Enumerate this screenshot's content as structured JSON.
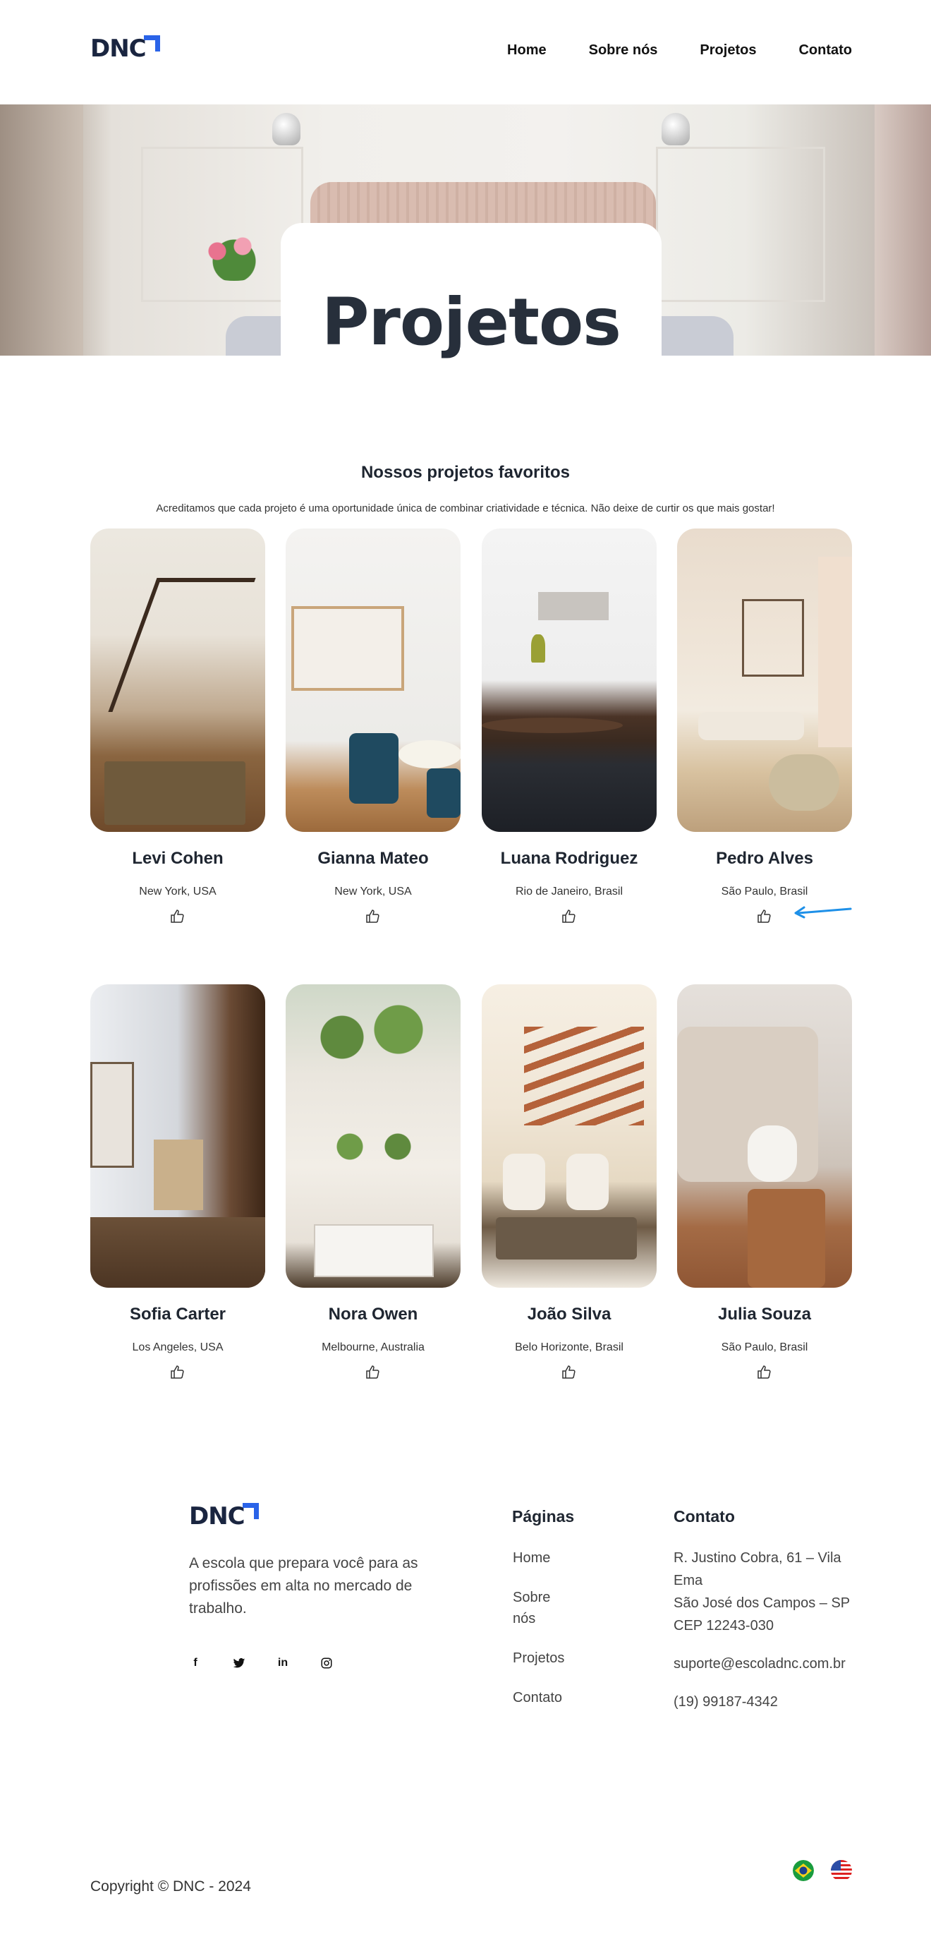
{
  "brand": {
    "logo_text": "DNC",
    "accent_color": "#2a63e8"
  },
  "nav": {
    "items": [
      {
        "label": "Home"
      },
      {
        "label": "Sobre nós"
      },
      {
        "label": "Projetos"
      },
      {
        "label": "Contato"
      }
    ]
  },
  "hero": {
    "title": "Projetos"
  },
  "section": {
    "heading": "Nossos projetos favoritos",
    "subtitle": "Acreditamos que cada projeto é uma oportunidade única de combinar criatividade e técnica. Não deixe de curtir os que mais gostar!"
  },
  "projects": [
    {
      "name": "Levi Cohen",
      "location": "New York, USA",
      "like_icon": "thumbs-up-icon"
    },
    {
      "name": "Gianna Mateo",
      "location": "New York, USA",
      "like_icon": "thumbs-up-icon"
    },
    {
      "name": "Luana Rodriguez",
      "location": "Rio de Janeiro, Brasil",
      "like_icon": "thumbs-up-icon"
    },
    {
      "name": "Pedro Alves",
      "location": "São Paulo, Brasil",
      "like_icon": "thumbs-up-icon"
    },
    {
      "name": "Sofia Carter",
      "location": "Los Angeles, USA",
      "like_icon": "thumbs-up-icon"
    },
    {
      "name": "Nora Owen",
      "location": "Melbourne, Australia",
      "like_icon": "thumbs-up-icon"
    },
    {
      "name": "João Silva",
      "location": "Belo Horizonte, Brasil",
      "like_icon": "thumbs-up-icon"
    },
    {
      "name": "Julia Souza",
      "location": "São Paulo, Brasil",
      "like_icon": "thumbs-up-icon"
    }
  ],
  "annotation": {
    "arrow_color": "#1e90e8"
  },
  "footer": {
    "logo_text": "DNC",
    "tagline": "A escola que prepara você para as profissões em alta no mercado de trabalho.",
    "social": [
      {
        "icon": "facebook-icon",
        "glyph": "f"
      },
      {
        "icon": "twitter-icon",
        "glyph": "🐦"
      },
      {
        "icon": "linkedin-icon",
        "glyph": "in"
      },
      {
        "icon": "instagram-icon",
        "glyph": "◎"
      }
    ],
    "pages_title": "Páginas",
    "pages": [
      {
        "label": "Home"
      },
      {
        "label": "Sobre nós"
      },
      {
        "label": "Projetos"
      },
      {
        "label": "Contato"
      }
    ],
    "contact_title": "Contato",
    "address_line1": "R. Justino Cobra, 61 – Vila Ema",
    "address_line2": "São José dos Campos – SP",
    "address_line3": "CEP 12243-030",
    "email": "suporte@escoladnc.com.br",
    "phone": "(19) 99187-4342",
    "copyright": "Copyright © DNC - 2024",
    "languages": [
      {
        "icon": "brazil-flag-icon"
      },
      {
        "icon": "usa-flag-icon"
      }
    ]
  }
}
